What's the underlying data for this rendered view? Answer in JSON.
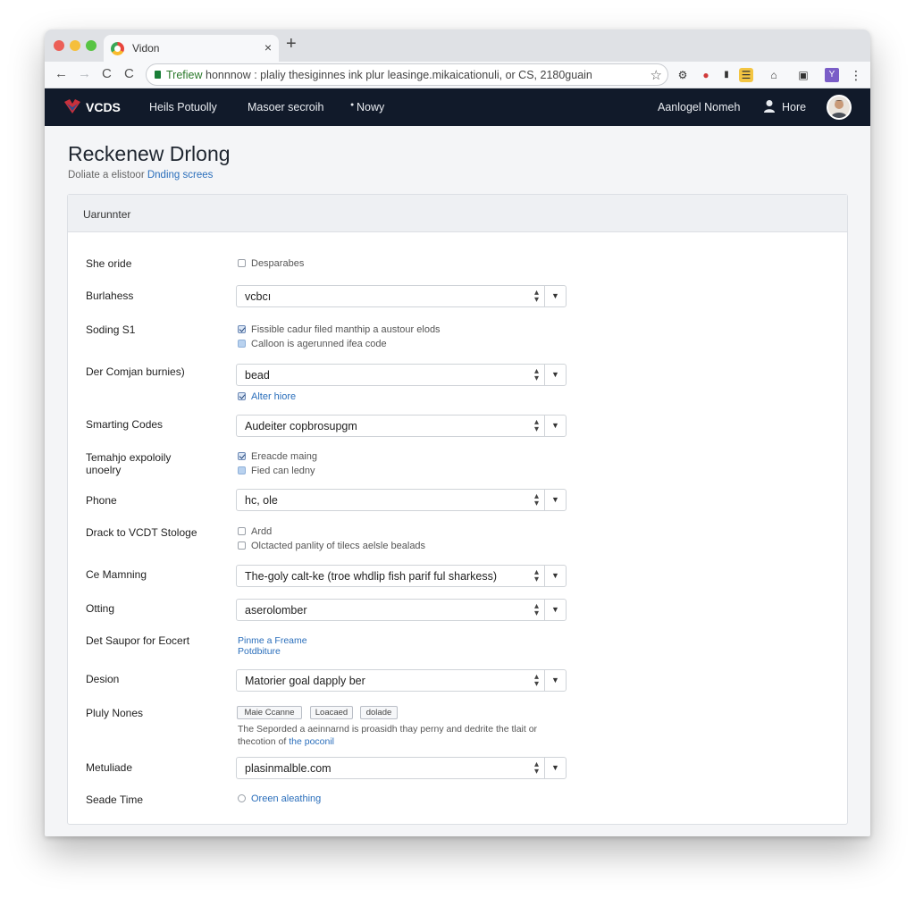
{
  "browser": {
    "tab_title": "Vidon",
    "tab_close": "×",
    "new_tab": "+",
    "url_host": "Trefiew",
    "url_rest": " honnnow : plaliy thesiginnes ink plur leasinge.mikaicationuli, or CS, 2180guain",
    "colors": {
      "dot_red": "#ec5f57",
      "dot_yellow": "#f5bf3c",
      "dot_green": "#58c443"
    }
  },
  "appbar": {
    "logo_text": "VCDS",
    "nav": [
      "Heils Potuolly",
      "Masoer secroih",
      "Nowy"
    ],
    "account_link": "Aanlogel Nomeh",
    "home_link": "Hore",
    "background": "#111a2a"
  },
  "page": {
    "title": "Reckenew Drlong",
    "subtitle": "Doliate a elistoor",
    "subtitle_link": "Dnding screes"
  },
  "panel": {
    "header": "Uarunnter",
    "rows": [
      {
        "label": "She oride"
      },
      {
        "label": "Burlahess",
        "select": "vcbcı"
      },
      {
        "label": "Soding S1"
      },
      {
        "label": "Der Comjan burnies)",
        "select": "bead"
      },
      {
        "label": "Smarting Codes",
        "select": "Audeiter copbrosupgm"
      },
      {
        "label": "Temahjo expoloily unoelry"
      },
      {
        "label": "Phone",
        "select": "hc, ole"
      },
      {
        "label": "Drack to VCDT Stologe"
      },
      {
        "label": "Ce Mamning",
        "select": "The-goly calt-ke (troe whdlip fish parif ful sharkess)"
      },
      {
        "label": "Otting",
        "select": "aserolomber"
      },
      {
        "label": "Det Saupor for Eocert"
      },
      {
        "label": "Desion",
        "select": "Matorier goal dapply ber"
      },
      {
        "label": "Pluly Nones"
      },
      {
        "label": "Metuliade",
        "select": "plasinmalble.com"
      },
      {
        "label": "Seade Time"
      }
    ],
    "checks": {
      "desparabes": "Desparabes",
      "flssible": "Fissible cadur filed manthip a austour elods",
      "calloon": "Calloon is agerunned ifea code",
      "alter_hiore": "Alter hiore",
      "ereacde": "Ereacde maing",
      "fied": "Fied can ledny",
      "ardd": "Ardd",
      "olctacted": "Olctacted panlity of tilecs aelsle bealads",
      "oreen": "Oreen aleathing"
    },
    "link_lines": [
      "Pinme a Freame",
      "Potdbiture"
    ],
    "chips": [
      "Maie Ccanne",
      "Loacaed",
      "dolade"
    ],
    "desc_text": "The Seporded a aeinnarnd is proasidh thay perny and dedrite the tlait or thecotion of",
    "desc_link": "the poconil"
  }
}
